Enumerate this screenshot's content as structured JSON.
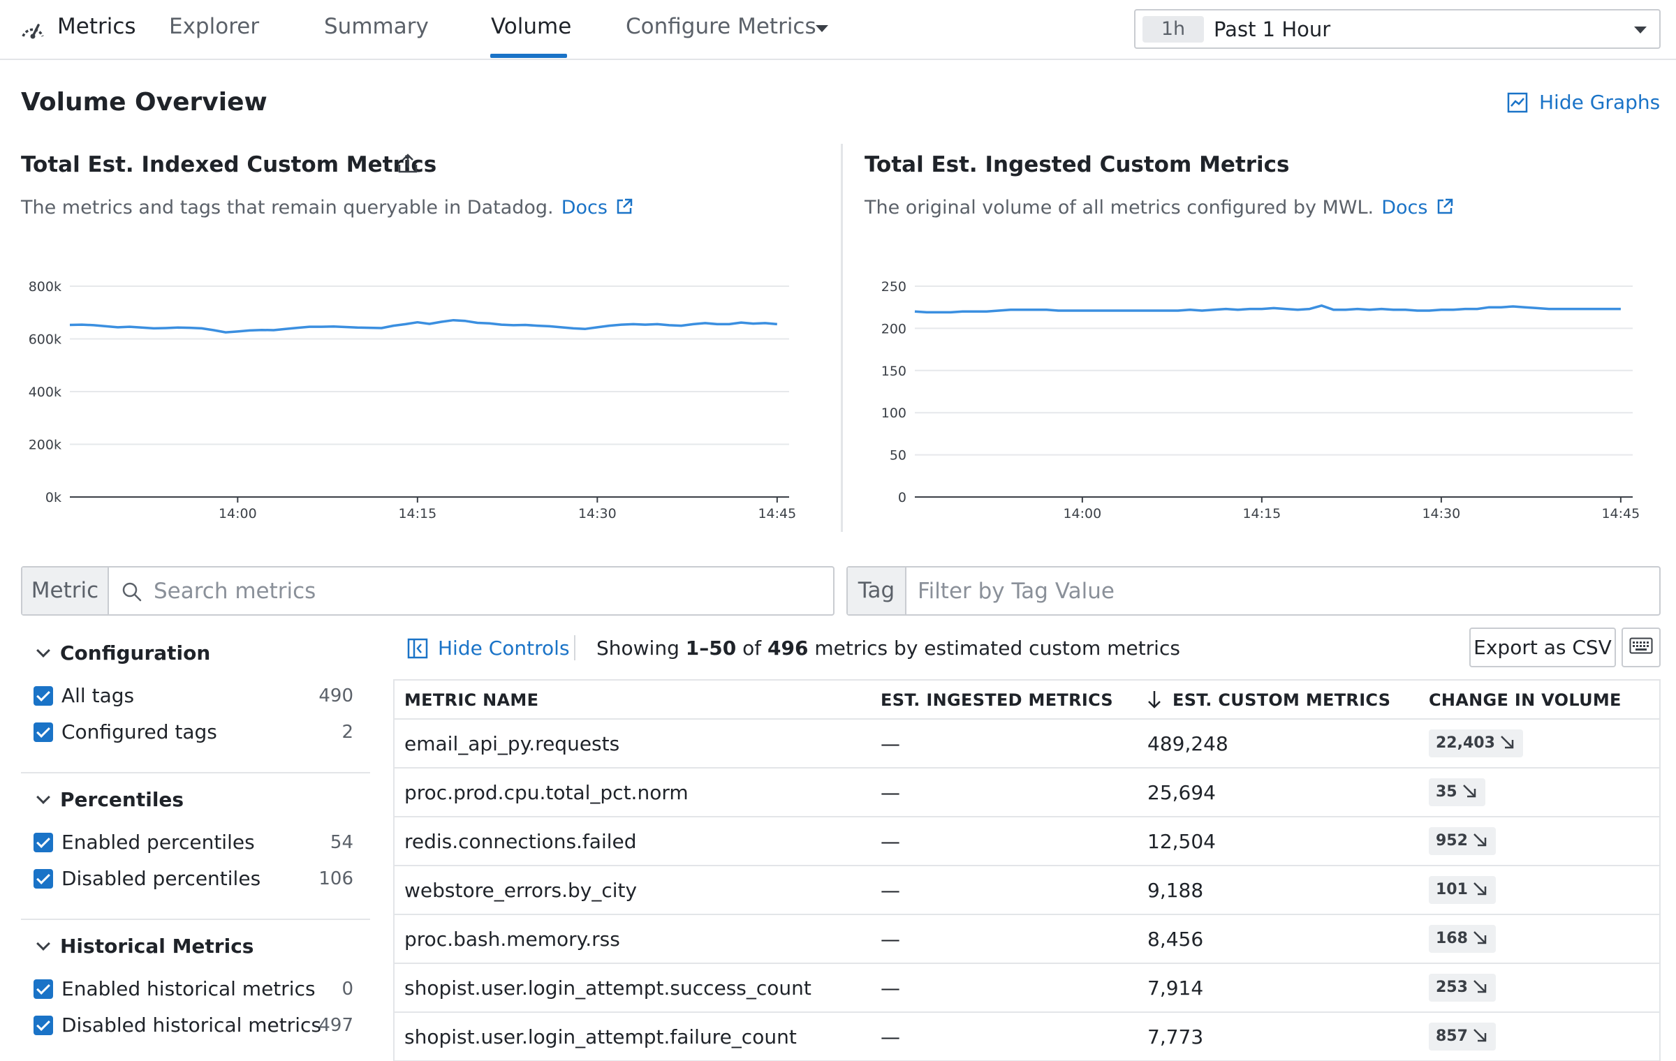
{
  "nav": {
    "app_name": "Metrics",
    "tabs": [
      {
        "label": "Explorer"
      },
      {
        "label": "Summary"
      },
      {
        "label": "Volume"
      },
      {
        "label": "Configure Metrics"
      }
    ],
    "active_tab": "Volume",
    "time_badge": "1h",
    "time_label": "Past 1 Hour"
  },
  "overview": {
    "title": "Volume Overview",
    "hide_graphs": "Hide Graphs"
  },
  "charts": [
    {
      "title": "Total Est. Indexed Custom Metrics",
      "description": "The metrics and tags that remain queryable in Datadog.",
      "docs_label": "Docs"
    },
    {
      "title": "Total Est. Ingested Custom Metrics",
      "description": "The original volume of all metrics configured by MWL.",
      "docs_label": "Docs"
    }
  ],
  "chart_data": [
    {
      "type": "line",
      "title": "Total Est. Indexed Custom Metrics",
      "ylim": [
        0,
        800000
      ],
      "yticks": [
        0,
        200000,
        400000,
        600000,
        800000
      ],
      "ytick_labels": [
        "0k",
        "200k",
        "400k",
        "600k",
        "800k"
      ],
      "xlim": [
        -14,
        46
      ],
      "xticks": [
        0,
        15,
        30,
        45
      ],
      "xtick_labels": [
        "14:00",
        "14:15",
        "14:30",
        "14:45"
      ],
      "grid": true,
      "color": "#3b8fe0",
      "series": [
        {
          "x": [
            -14,
            -13,
            -12,
            -11,
            -10,
            -9,
            -8,
            -7,
            -6,
            -5,
            -4,
            -3,
            -2,
            -1,
            0,
            1,
            2,
            3,
            4,
            5,
            6,
            7,
            8,
            9,
            10,
            11,
            12,
            13,
            14,
            15,
            16,
            17,
            18,
            19,
            20,
            21,
            22,
            23,
            24,
            25,
            26,
            27,
            28,
            29,
            30,
            31,
            32,
            33,
            34,
            35,
            36,
            37,
            38,
            39,
            40,
            41,
            42,
            43,
            44,
            45
          ],
          "values": [
            653000,
            654000,
            652000,
            648000,
            644000,
            646000,
            643000,
            640000,
            641000,
            643000,
            642000,
            640000,
            633000,
            625000,
            628000,
            632000,
            634000,
            633000,
            638000,
            642000,
            646000,
            646000,
            647000,
            645000,
            643000,
            642000,
            641000,
            650000,
            656000,
            663000,
            657000,
            665000,
            671000,
            668000,
            661000,
            659000,
            654000,
            652000,
            653000,
            650000,
            648000,
            644000,
            640000,
            638000,
            644000,
            650000,
            654000,
            656000,
            654000,
            656000,
            652000,
            650000,
            656000,
            660000,
            656000,
            656000,
            662000,
            658000,
            660000,
            656000
          ]
        }
      ]
    },
    {
      "type": "line",
      "title": "Total Est. Ingested Custom Metrics",
      "ylim": [
        0,
        250
      ],
      "yticks": [
        0,
        50,
        100,
        150,
        200,
        250
      ],
      "ytick_labels": [
        "0",
        "50",
        "100",
        "150",
        "200",
        "250"
      ],
      "xlim": [
        -14,
        46
      ],
      "xticks": [
        0,
        15,
        30,
        45
      ],
      "xtick_labels": [
        "14:00",
        "14:15",
        "14:30",
        "14:45"
      ],
      "grid": true,
      "color": "#3b8fe0",
      "series": [
        {
          "x": [
            -14,
            -13,
            -12,
            -11,
            -10,
            -9,
            -8,
            -7,
            -6,
            -5,
            -4,
            -3,
            -2,
            -1,
            0,
            1,
            2,
            3,
            4,
            5,
            6,
            7,
            8,
            9,
            10,
            11,
            12,
            13,
            14,
            15,
            16,
            17,
            18,
            19,
            20,
            21,
            22,
            23,
            24,
            25,
            26,
            27,
            28,
            29,
            30,
            31,
            32,
            33,
            34,
            35,
            36,
            37,
            38,
            39,
            40,
            41,
            42,
            43,
            44,
            45
          ],
          "values": [
            220,
            219,
            219,
            219,
            220,
            220,
            220,
            221,
            222,
            222,
            222,
            222,
            221,
            221,
            221,
            221,
            221,
            221,
            221,
            221,
            221,
            221,
            221,
            222,
            221,
            222,
            223,
            222,
            223,
            223,
            224,
            223,
            222,
            223,
            227,
            222,
            222,
            223,
            222,
            223,
            222,
            222,
            221,
            221,
            222,
            222,
            223,
            223,
            225,
            225,
            226,
            225,
            224,
            223,
            223,
            223,
            223,
            223,
            223,
            223
          ]
        }
      ]
    }
  ],
  "search": {
    "metric_prefix": "Metric",
    "metric_placeholder": "Search metrics",
    "tag_prefix": "Tag",
    "tag_placeholder": "Filter by Tag Value"
  },
  "filters": [
    {
      "title": "Configuration",
      "items": [
        {
          "label": "All tags",
          "count": "490"
        },
        {
          "label": "Configured tags",
          "count": "2"
        }
      ]
    },
    {
      "title": "Percentiles",
      "items": [
        {
          "label": "Enabled percentiles",
          "count": "54"
        },
        {
          "label": "Disabled percentiles",
          "count": "106"
        }
      ]
    },
    {
      "title": "Historical Metrics",
      "items": [
        {
          "label": "Enabled historical metrics",
          "count": "0"
        },
        {
          "label": "Disabled historical metrics",
          "count": "497"
        }
      ]
    }
  ],
  "controls": {
    "hide_controls": "Hide Controls",
    "showing_prefix": "Showing",
    "showing_range": "1–50",
    "showing_of": "of",
    "showing_total": "496",
    "showing_suffix": "metrics by estimated custom metrics",
    "export_csv": "Export as CSV"
  },
  "table": {
    "columns": [
      "METRIC NAME",
      "EST. INGESTED METRICS",
      "EST. CUSTOM METRICS",
      "CHANGE IN VOLUME"
    ],
    "rows": [
      {
        "name": "email_api_py.requests",
        "ingested": "—",
        "custom": "489,248",
        "change": "22,403"
      },
      {
        "name": "proc.prod.cpu.total_pct.norm",
        "ingested": "—",
        "custom": "25,694",
        "change": "35"
      },
      {
        "name": "redis.connections.failed",
        "ingested": "—",
        "custom": "12,504",
        "change": "952"
      },
      {
        "name": "webstore_errors.by_city",
        "ingested": "—",
        "custom": "9,188",
        "change": "101"
      },
      {
        "name": "proc.bash.memory.rss",
        "ingested": "—",
        "custom": "8,456",
        "change": "168"
      },
      {
        "name": "shopist.user.login_attempt.success_count",
        "ingested": "—",
        "custom": "7,914",
        "change": "253"
      },
      {
        "name": "shopist.user.login_attempt.failure_count",
        "ingested": "—",
        "custom": "7,773",
        "change": "857"
      }
    ]
  }
}
